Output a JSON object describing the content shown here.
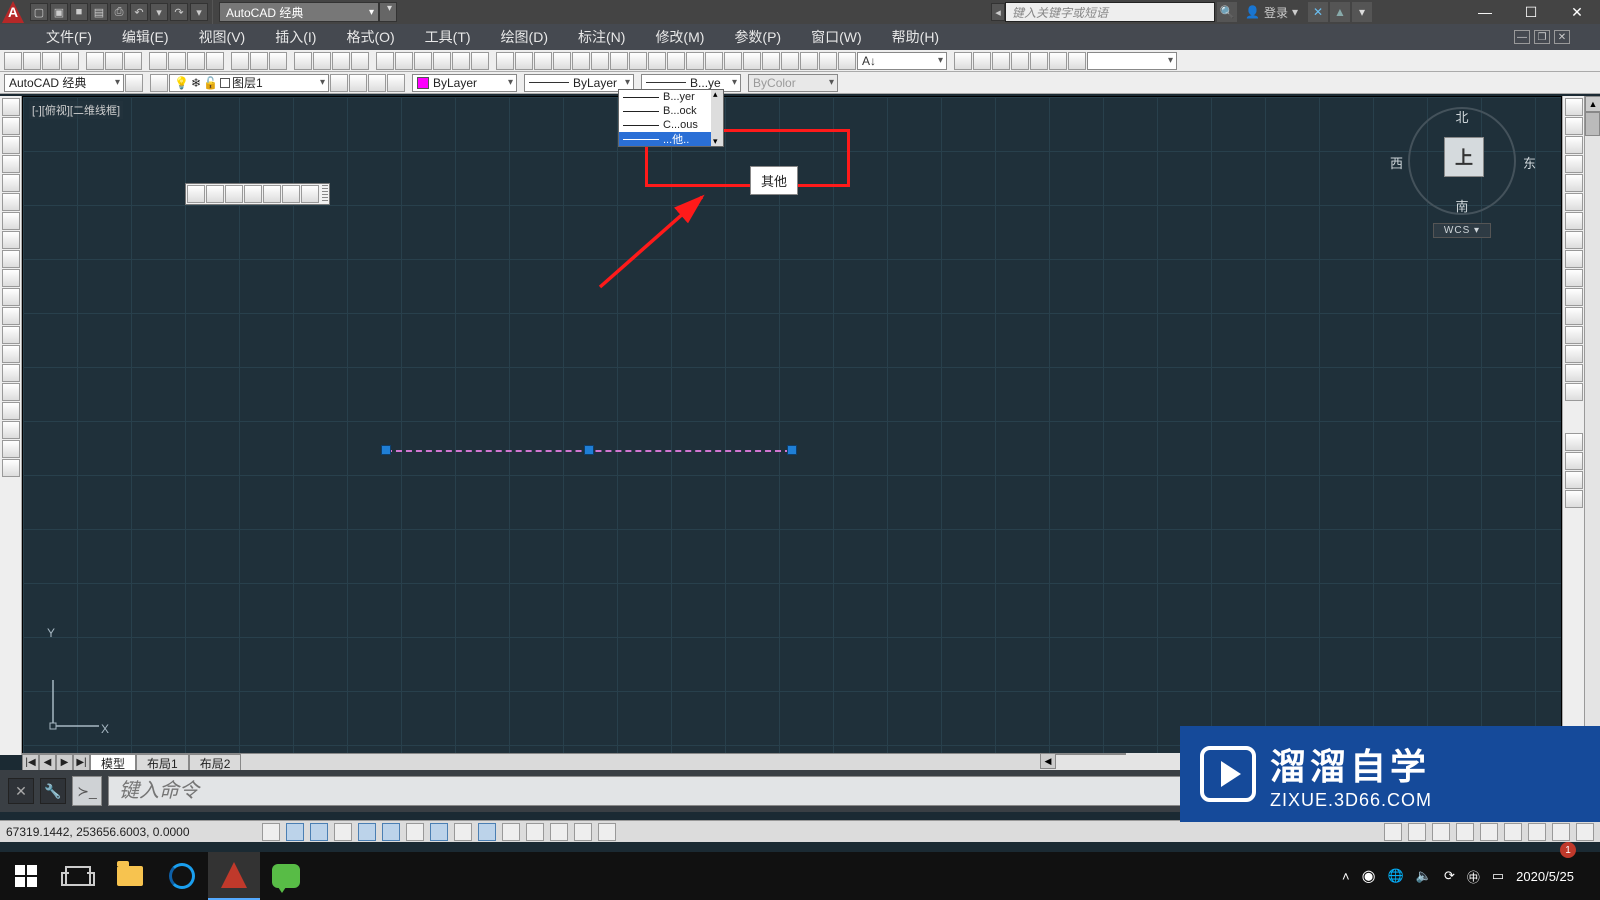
{
  "titlebar": {
    "workspace": "AutoCAD 经典",
    "search_placeholder": "键入关键字或短语",
    "login": "登录",
    "win": {
      "min": "—",
      "max": "☐",
      "close": "✕"
    }
  },
  "menubar": {
    "items": [
      "文件(F)",
      "编辑(E)",
      "视图(V)",
      "插入(I)",
      "格式(O)",
      "工具(T)",
      "绘图(D)",
      "标注(N)",
      "修改(M)",
      "参数(P)",
      "窗口(W)",
      "帮助(H)"
    ]
  },
  "props_row": {
    "workspace": "AutoCAD 经典",
    "layer": "图层1",
    "color": "ByLayer",
    "linetype": "ByLayer",
    "lineweight": "B...ye",
    "plotstyle": "ByColor"
  },
  "lw_dropdown": {
    "options": [
      "B...yer",
      "B...ock",
      "C...ous",
      "...他.."
    ],
    "selected_index": 3,
    "tooltip": "其他"
  },
  "viewport": {
    "label": "[-][俯视][二维线框]"
  },
  "viewcube": {
    "n": "北",
    "s": "南",
    "e": "东",
    "w": "西",
    "face": "上",
    "wcs": "WCS"
  },
  "ucs": {
    "y": "Y",
    "x": "X"
  },
  "tabs": {
    "nav": [
      "|◀",
      "◀",
      "▶",
      "▶|"
    ],
    "model": "模型",
    "layout1": "布局1",
    "layout2": "布局2"
  },
  "cmd": {
    "placeholder": "键入命令"
  },
  "status": {
    "coords": "67319.1442,  253656.6003,  0.0000"
  },
  "watermark": {
    "big": "溜溜自学",
    "small": "zixue.3d66.com"
  },
  "taskbar": {
    "date": "2020/5/25",
    "notif_count": "1"
  }
}
